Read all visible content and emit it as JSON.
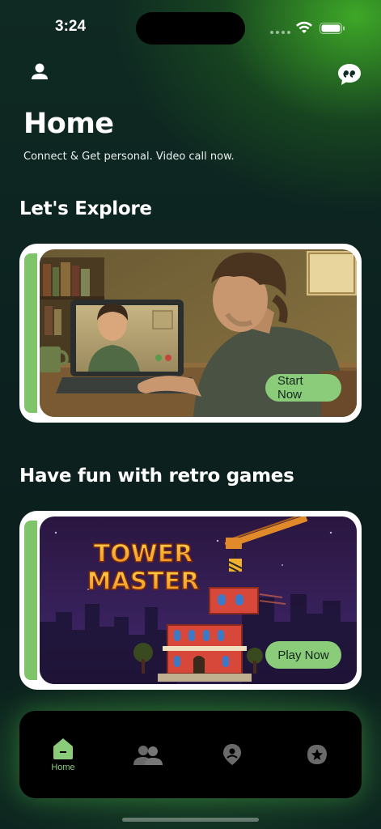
{
  "status_bar": {
    "time": "3:24",
    "icons": [
      "signal-dots-icon",
      "wifi-icon",
      "battery-icon"
    ]
  },
  "header": {
    "profile_icon": "person-icon",
    "chat_icon": "chat-bubble-icon",
    "title": "Home",
    "subtitle": "Connect & Get personal. Video call now."
  },
  "sections": [
    {
      "title": "Let's Explore",
      "card": {
        "image": "video-call-illustration",
        "button_label": "Start Now"
      }
    },
    {
      "title": "Have fun with retro games",
      "card": {
        "image": "tower-master-game-art",
        "art_title_line1": "TOWER",
        "art_title_line2": "MASTER",
        "button_label": "Play Now"
      }
    }
  ],
  "bottom_nav": {
    "items": [
      {
        "label": "Home",
        "icon": "home-icon",
        "active": true
      },
      {
        "label": "",
        "icon": "people-icon",
        "active": false
      },
      {
        "label": "",
        "icon": "location-pin-icon",
        "active": false
      },
      {
        "label": "",
        "icon": "star-badge-icon",
        "active": false
      }
    ]
  },
  "colors": {
    "accent": "#8bcc7a",
    "background": "#0c2220",
    "glow": "#46be28",
    "nav_bg": "#000000"
  }
}
